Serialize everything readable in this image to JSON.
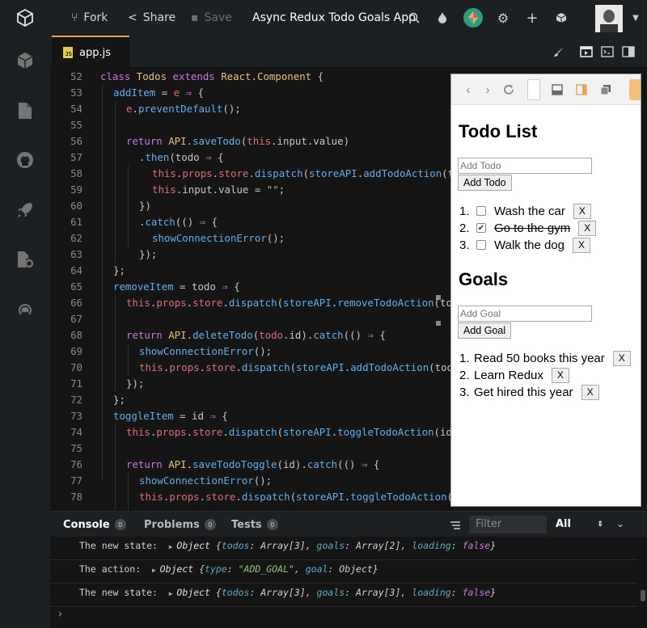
{
  "topbar": {
    "fork_label": "Fork",
    "share_label": "Share",
    "save_label": "Save",
    "title": "Async Redux Todo Goals App"
  },
  "editor": {
    "tab_label": "app.js",
    "tab_badge": "JS",
    "lines": [
      {
        "n": "52",
        "indent": 0,
        "tokens": [
          [
            "kw",
            "class "
          ],
          [
            "cls",
            "Todos "
          ],
          [
            "kw",
            "extends "
          ],
          [
            "cls",
            "React"
          ],
          [
            "pun",
            "."
          ],
          [
            "cls",
            "Component "
          ],
          [
            "pun",
            "{"
          ]
        ]
      },
      {
        "n": "53",
        "indent": 1,
        "tokens": [
          [
            "fn",
            "addItem "
          ],
          [
            "pun",
            "= "
          ],
          [
            "var",
            "e "
          ],
          [
            "arr",
            "⇒ "
          ],
          [
            "pun",
            "{"
          ]
        ]
      },
      {
        "n": "54",
        "indent": 2,
        "tokens": [
          [
            "var",
            "e"
          ],
          [
            "pun",
            "."
          ],
          [
            "fn",
            "preventDefault"
          ],
          [
            "pun",
            "();"
          ]
        ]
      },
      {
        "n": "55",
        "indent": 0,
        "tokens": []
      },
      {
        "n": "56",
        "indent": 2,
        "tokens": [
          [
            "kw",
            "return "
          ],
          [
            "cls",
            "API"
          ],
          [
            "pun",
            "."
          ],
          [
            "fn",
            "saveTodo"
          ],
          [
            "pun",
            "("
          ],
          [
            "var",
            "this"
          ],
          [
            "pun",
            ".input.value)"
          ]
        ]
      },
      {
        "n": "57",
        "indent": 3,
        "tokens": [
          [
            "pun",
            "."
          ],
          [
            "fn",
            "then"
          ],
          [
            "pun",
            "(todo "
          ],
          [
            "arr",
            "⇒ "
          ],
          [
            "pun",
            "{"
          ]
        ]
      },
      {
        "n": "58",
        "indent": 4,
        "tokens": [
          [
            "var",
            "this"
          ],
          [
            "pun",
            "."
          ],
          [
            "var",
            "props"
          ],
          [
            "pun",
            "."
          ],
          [
            "var",
            "store"
          ],
          [
            "pun",
            "."
          ],
          [
            "fn",
            "dispatch"
          ],
          [
            "pun",
            "("
          ],
          [
            "fn",
            "storeAPI"
          ],
          [
            "pun",
            "."
          ],
          [
            "fn",
            "addTodoAction"
          ],
          [
            "pun",
            "(t"
          ]
        ]
      },
      {
        "n": "59",
        "indent": 4,
        "tokens": [
          [
            "var",
            "this"
          ],
          [
            "pun",
            ".input.value = "
          ],
          [
            "str",
            "\"\""
          ],
          [
            "pun",
            ";"
          ]
        ]
      },
      {
        "n": "60",
        "indent": 3,
        "tokens": [
          [
            "pun",
            "})"
          ]
        ]
      },
      {
        "n": "61",
        "indent": 3,
        "tokens": [
          [
            "pun",
            "."
          ],
          [
            "fn",
            "catch"
          ],
          [
            "pun",
            "(() "
          ],
          [
            "arr",
            "⇒ "
          ],
          [
            "pun",
            "{"
          ]
        ]
      },
      {
        "n": "62",
        "indent": 4,
        "tokens": [
          [
            "fn",
            "showConnectionError"
          ],
          [
            "pun",
            "();"
          ]
        ]
      },
      {
        "n": "63",
        "indent": 3,
        "tokens": [
          [
            "pun",
            "});"
          ]
        ]
      },
      {
        "n": "64",
        "indent": 1,
        "tokens": [
          [
            "pun",
            "};"
          ]
        ]
      },
      {
        "n": "65",
        "indent": 1,
        "tokens": [
          [
            "fn",
            "removeItem "
          ],
          [
            "pun",
            "= todo "
          ],
          [
            "arr",
            "⇒ "
          ],
          [
            "pun",
            "{"
          ]
        ]
      },
      {
        "n": "66",
        "indent": 2,
        "tokens": [
          [
            "var",
            "this"
          ],
          [
            "pun",
            "."
          ],
          [
            "var",
            "props"
          ],
          [
            "pun",
            "."
          ],
          [
            "var",
            "store"
          ],
          [
            "pun",
            "."
          ],
          [
            "fn",
            "dispatch"
          ],
          [
            "pun",
            "("
          ],
          [
            "fn",
            "storeAPI"
          ],
          [
            "pun",
            "."
          ],
          [
            "fn",
            "removeTodoAction"
          ],
          [
            "pun",
            "(to"
          ]
        ]
      },
      {
        "n": "67",
        "indent": 0,
        "tokens": []
      },
      {
        "n": "68",
        "indent": 2,
        "tokens": [
          [
            "kw",
            "return "
          ],
          [
            "cls",
            "API"
          ],
          [
            "pun",
            "."
          ],
          [
            "fn",
            "deleteTodo"
          ],
          [
            "pun",
            "("
          ],
          [
            "var",
            "todo"
          ],
          [
            "pun",
            ".id)."
          ],
          [
            "fn",
            "catch"
          ],
          [
            "pun",
            "(() "
          ],
          [
            "arr",
            "⇒ "
          ],
          [
            "pun",
            "{"
          ]
        ]
      },
      {
        "n": "69",
        "indent": 3,
        "tokens": [
          [
            "fn",
            "showConnectionError"
          ],
          [
            "pun",
            "();"
          ]
        ]
      },
      {
        "n": "70",
        "indent": 3,
        "tokens": [
          [
            "var",
            "this"
          ],
          [
            "pun",
            "."
          ],
          [
            "var",
            "props"
          ],
          [
            "pun",
            "."
          ],
          [
            "var",
            "store"
          ],
          [
            "pun",
            "."
          ],
          [
            "fn",
            "dispatch"
          ],
          [
            "pun",
            "("
          ],
          [
            "fn",
            "storeAPI"
          ],
          [
            "pun",
            "."
          ],
          [
            "fn",
            "addTodoAction"
          ],
          [
            "pun",
            "(too"
          ]
        ]
      },
      {
        "n": "71",
        "indent": 2,
        "tokens": [
          [
            "pun",
            "});"
          ]
        ]
      },
      {
        "n": "72",
        "indent": 1,
        "tokens": [
          [
            "pun",
            "};"
          ]
        ]
      },
      {
        "n": "73",
        "indent": 1,
        "tokens": [
          [
            "fn",
            "toggleItem "
          ],
          [
            "pun",
            "= id "
          ],
          [
            "arr",
            "⇒ "
          ],
          [
            "pun",
            "{"
          ]
        ]
      },
      {
        "n": "74",
        "indent": 2,
        "tokens": [
          [
            "var",
            "this"
          ],
          [
            "pun",
            "."
          ],
          [
            "var",
            "props"
          ],
          [
            "pun",
            "."
          ],
          [
            "var",
            "store"
          ],
          [
            "pun",
            "."
          ],
          [
            "fn",
            "dispatch"
          ],
          [
            "pun",
            "("
          ],
          [
            "fn",
            "storeAPI"
          ],
          [
            "pun",
            "."
          ],
          [
            "fn",
            "toggleTodoAction"
          ],
          [
            "pun",
            "(id"
          ]
        ]
      },
      {
        "n": "75",
        "indent": 0,
        "tokens": []
      },
      {
        "n": "76",
        "indent": 2,
        "tokens": [
          [
            "kw",
            "return "
          ],
          [
            "cls",
            "API"
          ],
          [
            "pun",
            "."
          ],
          [
            "fn",
            "saveTodoToggle"
          ],
          [
            "pun",
            "(id)."
          ],
          [
            "fn",
            "catch"
          ],
          [
            "pun",
            "(() "
          ],
          [
            "arr",
            "⇒ "
          ],
          [
            "pun",
            "{"
          ]
        ]
      },
      {
        "n": "77",
        "indent": 3,
        "tokens": [
          [
            "fn",
            "showConnectionError"
          ],
          [
            "pun",
            "();"
          ]
        ]
      },
      {
        "n": "78",
        "indent": 3,
        "tokens": [
          [
            "var",
            "this"
          ],
          [
            "pun",
            "."
          ],
          [
            "var",
            "props"
          ],
          [
            "pun",
            "."
          ],
          [
            "var",
            "store"
          ],
          [
            "pun",
            "."
          ],
          [
            "fn",
            "dispatch"
          ],
          [
            "pun",
            "("
          ],
          [
            "fn",
            "storeAPI"
          ],
          [
            "pun",
            "."
          ],
          [
            "fn",
            "toggleTodoAction"
          ],
          [
            "pun",
            "("
          ]
        ]
      }
    ]
  },
  "preview": {
    "todo_heading": "Todo List",
    "todo_placeholder": "Add Todo",
    "todo_button": "Add Todo",
    "todos": [
      {
        "num": "1.",
        "text": "Wash the car",
        "done": false
      },
      {
        "num": "2.",
        "text": "Go to the gym",
        "done": true
      },
      {
        "num": "3.",
        "text": "Walk the dog",
        "done": false
      }
    ],
    "goals_heading": "Goals",
    "goal_placeholder": "Add Goal",
    "goal_button": "Add Goal",
    "goals": [
      {
        "num": "1.",
        "text": "Read 50 books this year"
      },
      {
        "num": "2.",
        "text": "Learn Redux"
      },
      {
        "num": "3.",
        "text": "Get hired this year"
      }
    ],
    "remove_label": "X"
  },
  "console": {
    "tabs": [
      {
        "label": "Console",
        "count": "0"
      },
      {
        "label": "Problems",
        "count": "0"
      },
      {
        "label": "Tests",
        "count": "0"
      }
    ],
    "filter_placeholder": "Filter",
    "level_select": "All",
    "logs": [
      {
        "label": "The new state:  ",
        "segments": [
          [
            "obj",
            "Object "
          ],
          [
            "val",
            "{"
          ],
          [
            "key",
            "todos"
          ],
          [
            "val",
            ": Array[3], "
          ],
          [
            "key",
            "goals"
          ],
          [
            "val",
            ": Array[2], "
          ],
          [
            "key",
            "loading"
          ],
          [
            "val",
            ": "
          ],
          [
            "kwv",
            "false"
          ],
          [
            "val",
            "}"
          ]
        ]
      },
      {
        "label": "The action:  ",
        "segments": [
          [
            "obj",
            "Object "
          ],
          [
            "val",
            "{"
          ],
          [
            "key",
            "type"
          ],
          [
            "val",
            ": "
          ],
          [
            "sv",
            "\"ADD_GOAL\""
          ],
          [
            "val",
            ", "
          ],
          [
            "key",
            "goal"
          ],
          [
            "val",
            ": Object}"
          ]
        ]
      },
      {
        "label": "The new state:  ",
        "segments": [
          [
            "obj",
            "Object "
          ],
          [
            "val",
            "{"
          ],
          [
            "key",
            "todos"
          ],
          [
            "val",
            ": Array[3], "
          ],
          [
            "key",
            "goals"
          ],
          [
            "val",
            ": Array[3], "
          ],
          [
            "key",
            "loading"
          ],
          [
            "val",
            ": "
          ],
          [
            "kwv",
            "false"
          ],
          [
            "val",
            "}"
          ]
        ]
      }
    ],
    "prompt": "›"
  }
}
